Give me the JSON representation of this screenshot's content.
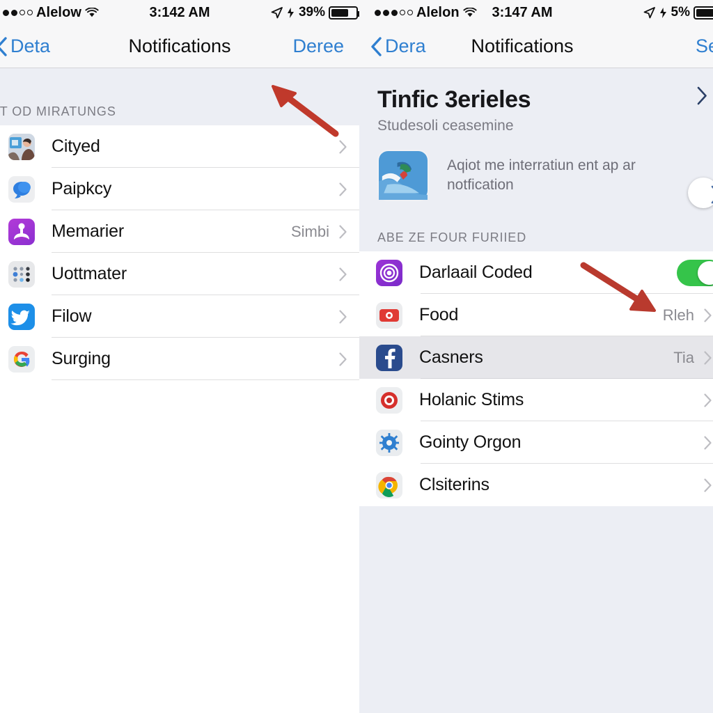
{
  "left": {
    "status_bar": {
      "signal_filled": 2,
      "signal_hollow": 2,
      "carrier": "Alelow",
      "wifi_icon": "wifi-icon",
      "time": "3:142 AM",
      "location_icon": "location-arrow-icon",
      "alarm_icon": "alarm-icon",
      "battery_percent": "39%",
      "battery_icon": "battery-icon"
    },
    "nav": {
      "back_icon": "chevron-left-icon",
      "back_label": "Deta",
      "title": "Notifications",
      "right_label": "Deree"
    },
    "group_header": "IIT OD MIRATUNGS",
    "rows": [
      {
        "icon": "photos-app-icon",
        "label": "Cityed",
        "value": "",
        "chevron": "chevron-right-icon"
      },
      {
        "icon": "messages-app-icon",
        "label": "Paipkcy",
        "value": "",
        "chevron": "chevron-right-icon"
      },
      {
        "icon": "podcast-app-icon",
        "label": "Memarier",
        "value": "Simbi",
        "chevron": "chevron-right-icon"
      },
      {
        "icon": "grid-app-icon",
        "label": "Uottmater",
        "value": "",
        "chevron": "chevron-right-icon"
      },
      {
        "icon": "twitter-app-icon",
        "label": "Filow",
        "value": "",
        "chevron": "chevron-right-icon"
      },
      {
        "icon": "google-app-icon",
        "label": "Surging",
        "value": "",
        "chevron": "chevron-right-icon"
      }
    ]
  },
  "right": {
    "status_bar": {
      "signal_filled": 3,
      "signal_hollow": 2,
      "carrier": "Alelon",
      "wifi_icon": "wifi-icon",
      "time": "3:147 AM",
      "location_icon": "location-arrow-icon",
      "alarm_icon": "alarm-icon",
      "battery_percent": "5%",
      "battery_icon": "battery-icon"
    },
    "nav": {
      "back_icon": "chevron-left-icon",
      "back_label": "Dera",
      "title": "Notifications",
      "right_label": "Sei"
    },
    "hero": {
      "title": "Tinfic 3erieles",
      "subtitle": "Studesoli ceasemine",
      "chevron": "chevron-right-icon",
      "card_icon": "maps-app-icon",
      "card_text": "Aqiot me interratiun ent ap ar notfication",
      "card_toggle_state": "off",
      "card_chevron": "chevron-right-icon"
    },
    "group_header": "ABE ZE FOUR FURIIED",
    "rows": [
      {
        "icon": "instagram-app-icon",
        "label": "Darlaail Coded",
        "value": "",
        "control": "toggle",
        "toggle_state": "on",
        "selected": false
      },
      {
        "icon": "youtube-app-icon",
        "label": "Food",
        "value": "Rleh",
        "control": "chevron",
        "chevron": "chevron-right-icon",
        "selected": false
      },
      {
        "icon": "facebook-app-icon",
        "label": "Casners",
        "value": "Tia",
        "control": "chevron",
        "chevron": "chevron-right-icon",
        "selected": true
      },
      {
        "icon": "target-app-icon",
        "label": "Holanic Stims",
        "value": "",
        "control": "chevron",
        "chevron": "chevron-right-icon",
        "selected": false
      },
      {
        "icon": "settings-app-icon",
        "label": "Gointy Orgon",
        "value": "",
        "control": "chevron",
        "chevron": "chevron-right-icon",
        "selected": false
      },
      {
        "icon": "chrome-app-icon",
        "label": "Clsiterins",
        "value": "",
        "control": "chevron",
        "chevron": "chevron-right-icon",
        "selected": false
      }
    ]
  },
  "annotations": {
    "arrow_left": {
      "name": "red-arrow-up-left-icon",
      "color": "#c0392b"
    },
    "arrow_right": {
      "name": "red-arrow-down-right-icon",
      "color": "#b93a2e"
    }
  },
  "colors": {
    "accent_blue": "#2f7fd0",
    "toggle_on_green": "#35c44a",
    "panel_gray": "#eceef4",
    "selected_row": "#e6e6ea",
    "annotation_red": "#c0392b"
  }
}
